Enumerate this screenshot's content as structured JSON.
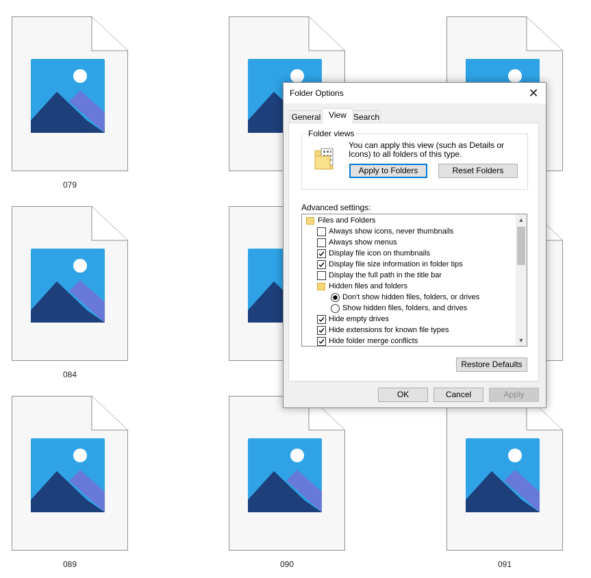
{
  "files": [
    {
      "label": "079"
    },
    {
      "label": "0"
    },
    {
      "label": ""
    },
    {
      "label": "084"
    },
    {
      "label": "0"
    },
    {
      "label": ""
    },
    {
      "label": "089"
    },
    {
      "label": "090"
    },
    {
      "label": "091"
    }
  ],
  "dialog": {
    "title": "Folder Options",
    "close_icon": "close-icon",
    "tabs": [
      {
        "label": "General"
      },
      {
        "label": "View",
        "active": true
      },
      {
        "label": "Search"
      }
    ],
    "folder_views": {
      "group_label": "Folder views",
      "description": "You can apply this view (such as Details or Icons) to all folders of this type.",
      "apply_button": "Apply to Folders",
      "reset_button": "Reset Folders"
    },
    "advanced": {
      "label": "Advanced settings:",
      "items": [
        {
          "type": "folder",
          "label": "Files and Folders",
          "level": 0
        },
        {
          "type": "checkbox",
          "label": "Always show icons, never thumbnails",
          "checked": false,
          "level": 1
        },
        {
          "type": "checkbox",
          "label": "Always show menus",
          "checked": false,
          "level": 1
        },
        {
          "type": "checkbox",
          "label": "Display file icon on thumbnails",
          "checked": true,
          "level": 1
        },
        {
          "type": "checkbox",
          "label": "Display file size information in folder tips",
          "checked": true,
          "level": 1
        },
        {
          "type": "checkbox",
          "label": "Display the full path in the title bar",
          "checked": false,
          "level": 1
        },
        {
          "type": "folder",
          "label": "Hidden files and folders",
          "level": 1
        },
        {
          "type": "radio",
          "label": "Don't show hidden files, folders, or drives",
          "checked": true,
          "level": 2
        },
        {
          "type": "radio",
          "label": "Show hidden files, folders, and drives",
          "checked": false,
          "level": 2
        },
        {
          "type": "checkbox",
          "label": "Hide empty drives",
          "checked": true,
          "level": 1
        },
        {
          "type": "checkbox",
          "label": "Hide extensions for known file types",
          "checked": true,
          "level": 1
        },
        {
          "type": "checkbox",
          "label": "Hide folder merge conflicts",
          "checked": true,
          "level": 1
        }
      ]
    },
    "restore_button": "Restore Defaults",
    "ok_button": "OK",
    "cancel_button": "Cancel",
    "apply_button": "Apply"
  },
  "colors": {
    "accent": "#0078d7",
    "folder": "#f5d77a",
    "image_sky": "#2fa3e6",
    "image_mountain": "#1d3f7a"
  }
}
